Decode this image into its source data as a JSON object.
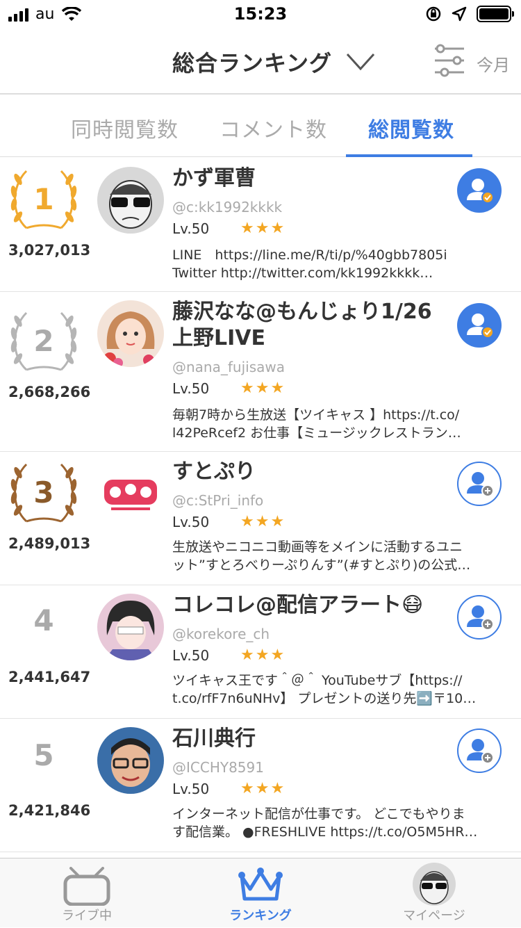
{
  "status_bar": {
    "carrier": "au",
    "time": "15:23"
  },
  "header": {
    "title": "総合ランキング",
    "period": "今月"
  },
  "tabs": [
    {
      "label": "同時閲覧数",
      "active": false
    },
    {
      "label": "コメント数",
      "active": false
    },
    {
      "label": "総閲覧数",
      "active": true
    }
  ],
  "rankings": [
    {
      "rank": "1",
      "count": "3,027,013",
      "name": "かず軍曹",
      "handle": "@c:kk1992kkkk",
      "level": "Lv.50",
      "stars": 3,
      "desc_lines": [
        "LINE　https://line.me/R/ti/p/%40gbb7805i",
        "Twitter http://twitter.com/kk1992kkkk…"
      ],
      "followed": true
    },
    {
      "rank": "2",
      "count": "2,668,266",
      "name": "藤沢なな@もんじょり1/26上野LIVE",
      "handle": "@nana_fujisawa",
      "level": "Lv.50",
      "stars": 3,
      "desc_lines": [
        "毎朝7時から生放送【ツイキャス 】https://t.co/",
        "l42PeRcef2 お仕事【ミュージックレストラン…"
      ],
      "followed": true
    },
    {
      "rank": "3",
      "count": "2,489,013",
      "name": "すとぷり",
      "handle": "@c:StPri_info",
      "level": "Lv.50",
      "stars": 3,
      "desc_lines": [
        "生放送やニコニコ動画等をメインに活動するユニ",
        "ット”すとろべりーぷりんす”(#すとぷり)の公式…"
      ],
      "followed": false
    },
    {
      "rank": "4",
      "count": "2,441,647",
      "name": "コレコレ@配信アラート😷",
      "handle": "@korekore_ch",
      "level": "Lv.50",
      "stars": 3,
      "desc_lines": [
        "ツイキャス王です＾＠＾ YouTubeサブ【https://",
        "t.co/rfF7n6uNHv】 プレゼントの送り先➡️〒10…"
      ],
      "followed": false
    },
    {
      "rank": "5",
      "count": "2,421,846",
      "name": "石川典行",
      "handle": "@ICCHY8591",
      "level": "Lv.50",
      "stars": 3,
      "desc_lines": [
        "インターネット配信が仕事です。 どこでもやりま",
        "す配信業。 ●FRESHLIVE https://t.co/O5M5HR…"
      ],
      "followed": false
    }
  ],
  "tabbar": [
    {
      "label": "ライブ中",
      "icon": "tv-icon",
      "active": false
    },
    {
      "label": "ランキング",
      "icon": "crown-icon",
      "active": true
    },
    {
      "label": "マイページ",
      "icon": "avatar",
      "active": false
    }
  ],
  "colors": {
    "accent": "#3e7de3",
    "gold": "#f0a92e",
    "silver": "#b5b5b5",
    "bronze": "#9c6430",
    "star": "#f3a622"
  }
}
